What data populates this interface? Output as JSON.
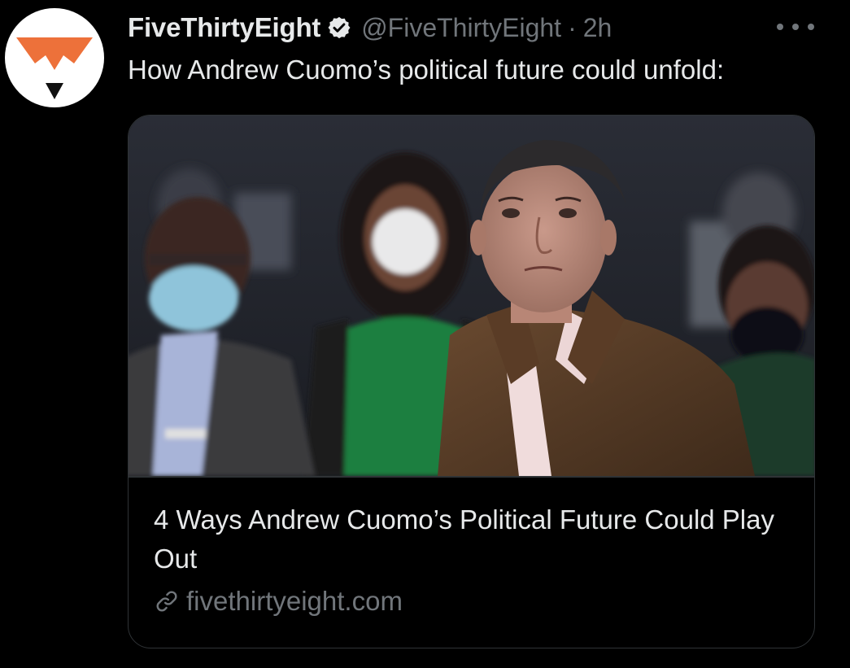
{
  "tweet": {
    "author": {
      "display_name": "FiveThirtyEight",
      "handle": "@FiveThirtyEight",
      "verified": true,
      "avatar_icon": "fivethirtyeight-fox-logo"
    },
    "separator": "·",
    "time": "2h",
    "text": "How Andrew Cuomo’s political future could unfold:",
    "more_icon": "more-horizontal-icon"
  },
  "card": {
    "image_alt": "Andrew Cuomo in a brown jacket standing in front of people wearing masks",
    "title": "4 Ways Andrew Cuomo’s Political Future Could Play Out",
    "domain": "fivethirtyeight.com",
    "link_icon": "link-icon"
  },
  "colors": {
    "background": "#000000",
    "text_primary": "#e7e9ea",
    "text_secondary": "#71767b",
    "border": "#2f3336",
    "logo_orange": "#ed713a",
    "verified_badge": "#e7e9ea"
  }
}
